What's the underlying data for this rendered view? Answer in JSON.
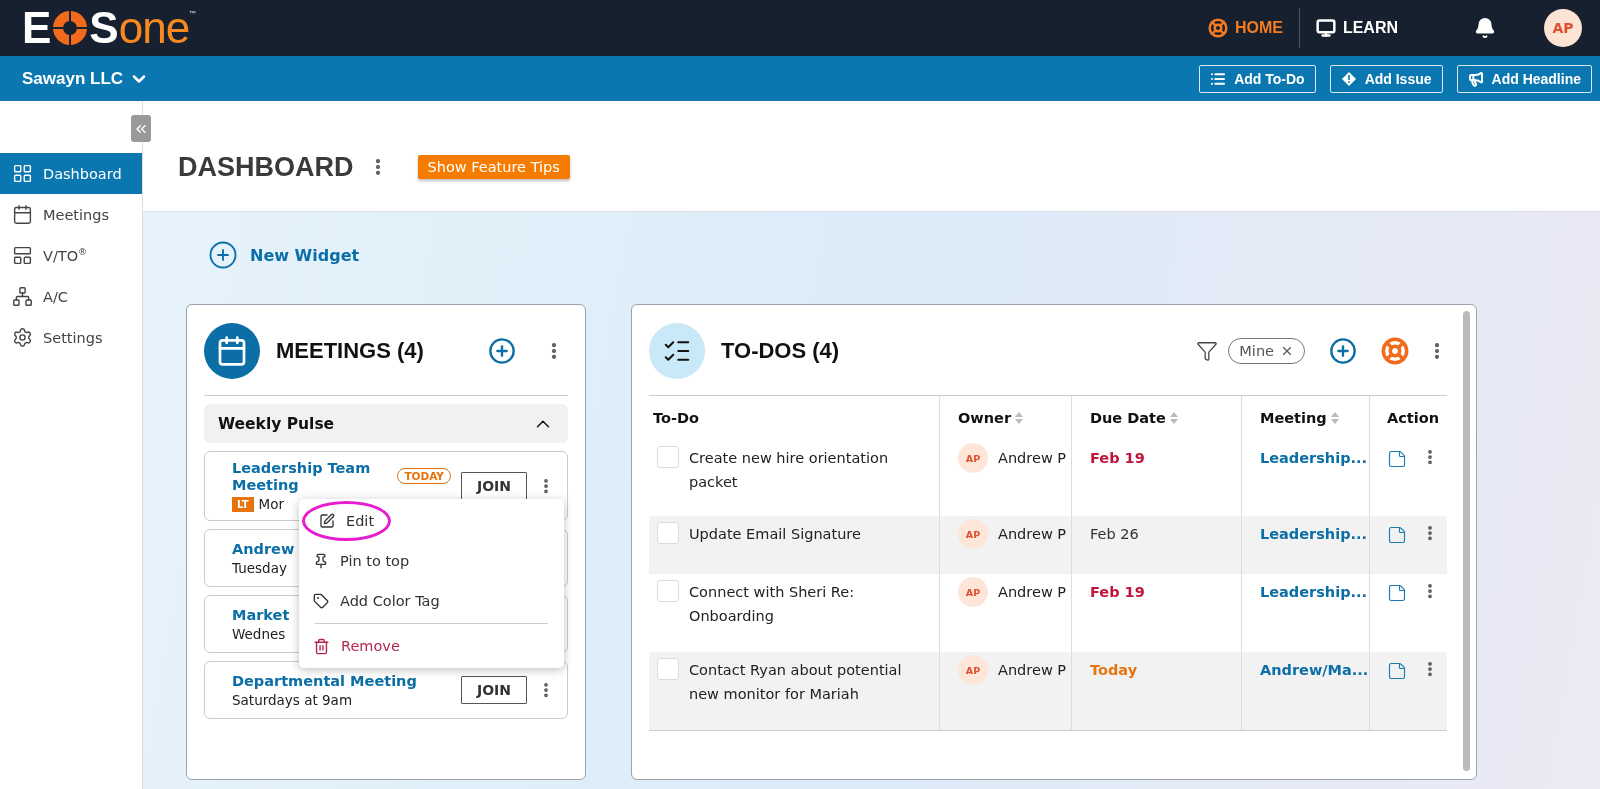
{
  "logo": {
    "lead": "E",
    "middle": "S",
    "tail": "one",
    "mark": "™"
  },
  "top_nav": [
    {
      "label": "HOME",
      "selected": true
    },
    {
      "label": "LEARN",
      "selected": false
    }
  ],
  "user": {
    "initials": "AP"
  },
  "company": {
    "name": "Sawayn LLC"
  },
  "quick_actions": [
    {
      "label": "Add To-Do"
    },
    {
      "label": "Add Issue"
    },
    {
      "label": "Add Headline"
    }
  ],
  "sidebar": {
    "items": [
      {
        "label": "Dashboard",
        "selected": true
      },
      {
        "label": "Meetings",
        "selected": false
      },
      {
        "label": "V/TO$^{®}$",
        "selected": false
      },
      {
        "label": "A/C",
        "selected": false
      },
      {
        "label": "Settings",
        "selected": false
      }
    ]
  },
  "page": {
    "title": "DASHBOARD",
    "tips_button": "Show Feature Tips",
    "new_widget": "New Widget"
  },
  "meetings_widget": {
    "title": "MEETINGS (4)",
    "group": {
      "label": "Weekly Pulse",
      "expanded": true
    },
    "meetings": [
      {
        "title": "Leadership Team Meeting",
        "badge": "TODAY",
        "tag": "LT",
        "schedule": "Mor",
        "join": "JOIN"
      },
      {
        "title": "Andrew",
        "schedule": "Tuesday"
      },
      {
        "title": "Market",
        "schedule": "Wednes"
      },
      {
        "title": "Departmental Meeting",
        "schedule": "Saturdays at 9am",
        "join": "JOIN"
      }
    ],
    "menu": [
      {
        "label": "Edit",
        "kind": "edit",
        "circled": true,
        "danger": false
      },
      {
        "label": "Pin to top",
        "kind": "pin",
        "circled": false,
        "danger": false
      },
      {
        "label": "Add Color Tag",
        "kind": "tag",
        "circled": false,
        "danger": false
      },
      {
        "label": "Remove",
        "kind": "trash",
        "circled": false,
        "danger": true
      }
    ]
  },
  "todos_widget": {
    "title": "TO-DOS (4)",
    "filter_chip": "Mine",
    "columns": [
      {
        "label": "To-Do",
        "sortable": false
      },
      {
        "label": "Owner",
        "sortable": true
      },
      {
        "label": "Due Date",
        "sortable": true
      },
      {
        "label": "Meeting",
        "sortable": true
      },
      {
        "label": "Action",
        "sortable": false
      }
    ],
    "rows": [
      {
        "checked": false,
        "todo": "Create new hire orientation packet",
        "owner_initials": "AP",
        "owner": "Andrew P",
        "due": "Feb 19",
        "kind": "overdue",
        "meeting": "Leadership..."
      },
      {
        "checked": false,
        "todo": "Update Email Signature",
        "owner_initials": "AP",
        "owner": "Andrew P",
        "due": "Feb 26",
        "kind": "upcoming",
        "meeting": "Leadership..."
      },
      {
        "checked": false,
        "todo": "Connect with Sheri Re: Onboarding",
        "owner_initials": "AP",
        "owner": "Andrew P",
        "due": "Feb 19",
        "kind": "overdue",
        "meeting": "Leadership..."
      },
      {
        "checked": false,
        "todo": "Contact Ryan about potential new monitor for Mariah",
        "owner_initials": "AP",
        "owner": "Andrew P",
        "due": "Today",
        "kind": "today",
        "meeting": "Andrew/Ma..."
      }
    ]
  }
}
